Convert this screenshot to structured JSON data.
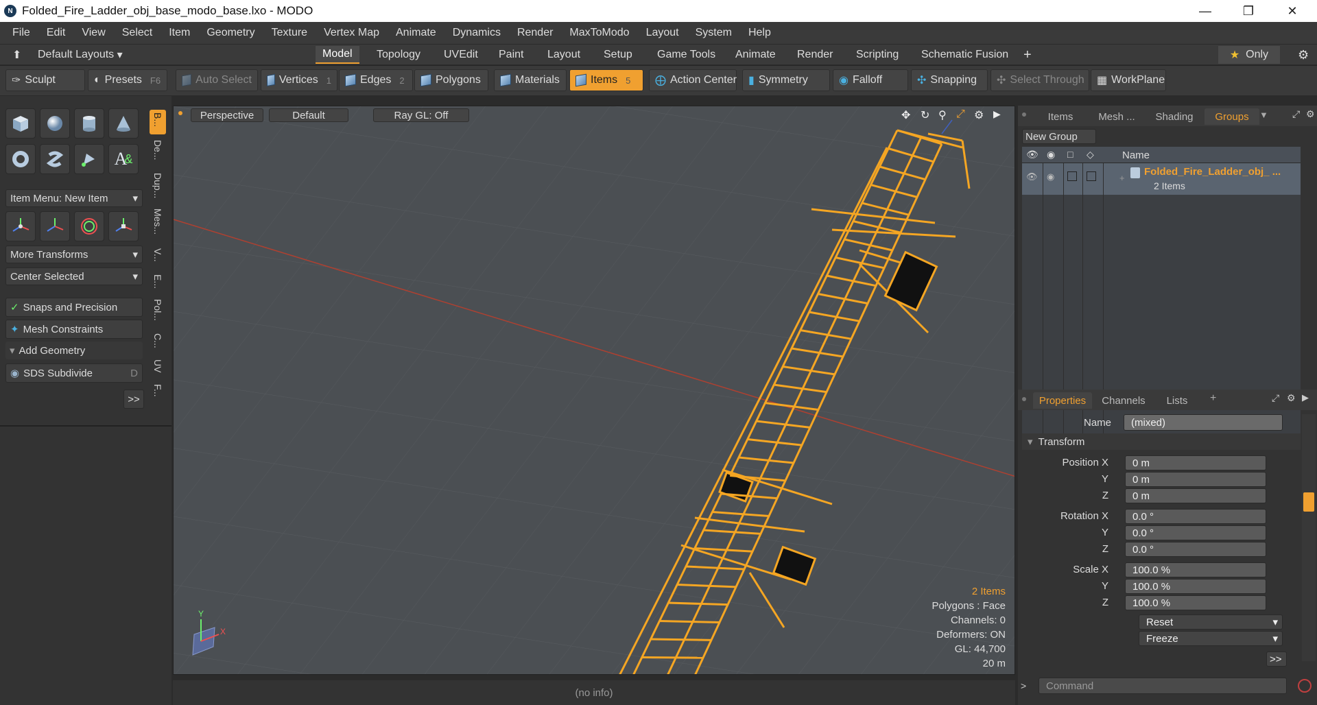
{
  "title": "Folded_Fire_Ladder_obj_base_modo_base.lxo - MODO",
  "menu": [
    "File",
    "Edit",
    "View",
    "Select",
    "Item",
    "Geometry",
    "Texture",
    "Vertex Map",
    "Animate",
    "Dynamics",
    "Render",
    "MaxToModo",
    "Layout",
    "System",
    "Help"
  ],
  "layout": {
    "preset": "Default Layouts",
    "tabs": [
      "Model",
      "Topology",
      "UVEdit",
      "Paint",
      "Layout",
      "Setup",
      "Game Tools",
      "Animate",
      "Render",
      "Scripting",
      "Schematic Fusion"
    ],
    "active": "Model",
    "only": "Only"
  },
  "toolbar": {
    "sculpt": "Sculpt",
    "presets": "Presets",
    "presets_key": "F6",
    "auto_select": "Auto Select",
    "vertices": "Vertices",
    "vertices_key": "1",
    "edges": "Edges",
    "edges_key": "2",
    "polygons": "Polygons",
    "materials": "Materials",
    "items": "Items",
    "items_key": "5",
    "action_center": "Action Center",
    "symmetry": "Symmetry",
    "falloff": "Falloff",
    "snapping": "Snapping",
    "select_through": "Select Through",
    "workplane": "WorkPlane"
  },
  "left": {
    "item_menu": "Item Menu: New Item",
    "more_transforms": "More Transforms",
    "center_selected": "Center Selected",
    "snaps": "Snaps and Precision",
    "mesh_constraints": "Mesh Constraints",
    "add_geometry": "Add Geometry",
    "sds": "SDS Subdivide",
    "sds_key": "D",
    "more": ">>",
    "vtabs": [
      "B...",
      "De...",
      "Dup...",
      "Mes...",
      "V...",
      "E...",
      "Pol...",
      "C...",
      "UV",
      "F..."
    ]
  },
  "viewport": {
    "view": "Perspective",
    "shading": "Default",
    "raygl": "Ray GL: Off"
  },
  "stats": {
    "items": "2 Items",
    "polygons": "Polygons : Face",
    "channels": "Channels: 0",
    "deformers": "Deformers: ON",
    "gl": "GL: 44,700",
    "scale": "20 m"
  },
  "status": "(no info)",
  "scene": {
    "tabs": [
      "Items",
      "Mesh ...",
      "Shading",
      "Groups"
    ],
    "new_group": "New Group",
    "name_col": "Name",
    "group_name": "Folded_Fire_Ladder_obj_ ...",
    "group_count": "2 Items"
  },
  "props": {
    "tabs": [
      "Properties",
      "Channels",
      "Lists"
    ],
    "name_label": "Name",
    "name_value": "(mixed)",
    "section": "Transform",
    "pos_label": "Position X",
    "rot_label": "Rotation X",
    "scale_label": "Scale X",
    "pos": [
      "0 m",
      "0 m",
      "0 m"
    ],
    "rot": [
      "0.0 °",
      "0.0 °",
      "0.0 °"
    ],
    "scl": [
      "100.0 %",
      "100.0 %",
      "100.0 %"
    ],
    "y": "Y",
    "z": "Z",
    "reset": "Reset",
    "freeze": "Freeze",
    "more": ">>"
  },
  "command": "Command",
  "colors": {
    "accent": "#f0a030",
    "viewport": "#4b4f53",
    "mesh": "#f5a623"
  }
}
